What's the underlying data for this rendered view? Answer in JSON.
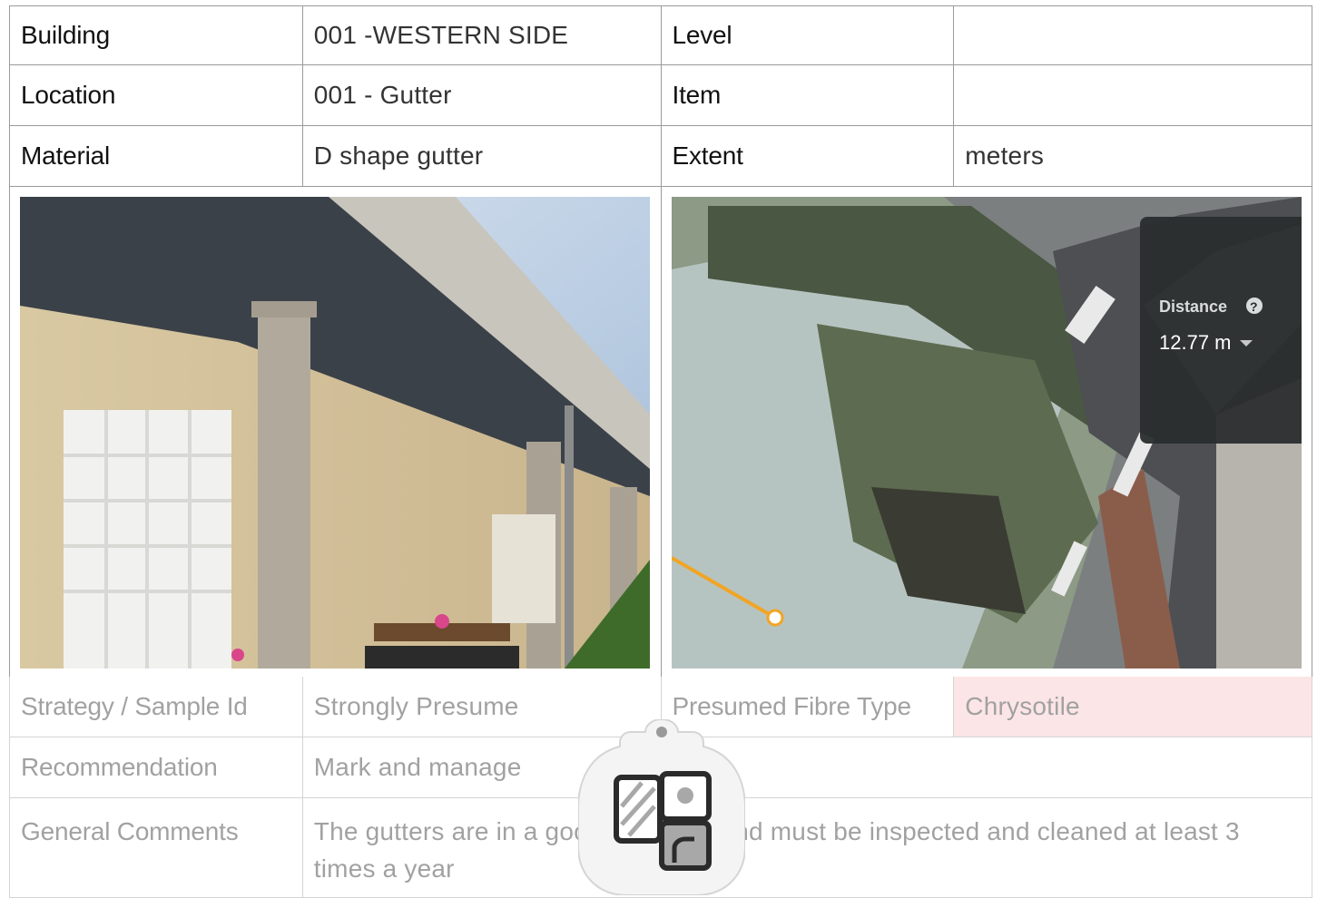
{
  "rows_top": [
    {
      "label1": "Building",
      "value1": "001 -WESTERN SIDE",
      "label2": "Level",
      "value2": ""
    },
    {
      "label1": "Location",
      "value1": "001 - Gutter",
      "label2": "Item",
      "value2": ""
    },
    {
      "label1": "Material",
      "value1": "D shape gutter",
      "label2": "Extent",
      "value2": "meters"
    }
  ],
  "map_overlay": {
    "label": "Distance",
    "value": "12.77 m",
    "help_icon": "question-circle-icon",
    "dropdown_icon": "caret-down-icon"
  },
  "rows_bottom": {
    "strategy": {
      "label": "Strategy / Sample Id",
      "value": "Strongly Presume",
      "label2": "Presumed Fibre Type",
      "value2": "Chrysotile"
    },
    "recommendation": {
      "label": "Recommendation",
      "value": "Mark and manage"
    },
    "comments": {
      "label": "General Comments",
      "value": "The gutters are in a good condition and must be inspected and cleaned at least 3 times a year"
    }
  },
  "colors": {
    "fibre_highlight": "#f9c3c6",
    "border": "#9a9a9a"
  },
  "floating_icon": "gallery-clipboard-icon"
}
